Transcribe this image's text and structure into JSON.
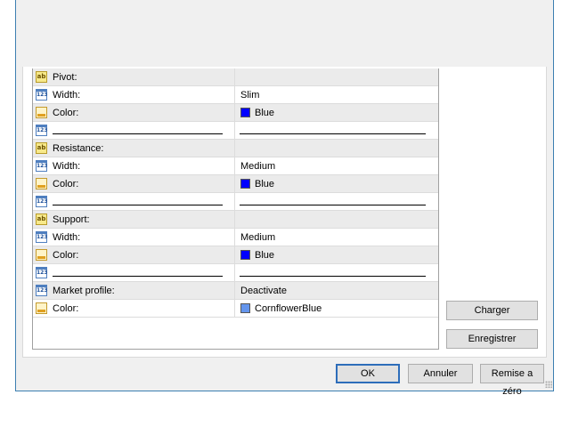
{
  "properties": [
    {
      "icon": "ab-icon",
      "label": "Pivot:",
      "value": "",
      "shaded": true
    },
    {
      "icon": "number-icon",
      "label": "Width:",
      "value": "Slim",
      "shaded": false
    },
    {
      "icon": "color-icon",
      "label": "Color:",
      "value": "Blue",
      "swatch": "#0000ff",
      "shaded": true
    },
    {
      "icon": "number-icon",
      "label": "",
      "value": "",
      "line": true,
      "shaded": false
    },
    {
      "icon": "ab-icon",
      "label": "Resistance:",
      "value": "",
      "shaded": true
    },
    {
      "icon": "number-icon",
      "label": "Width:",
      "value": "Medium",
      "shaded": false
    },
    {
      "icon": "color-icon",
      "label": "Color:",
      "value": "Blue",
      "swatch": "#0000ff",
      "shaded": true
    },
    {
      "icon": "number-icon",
      "label": "",
      "value": "",
      "line": true,
      "shaded": false
    },
    {
      "icon": "ab-icon",
      "label": "Support:",
      "value": "",
      "shaded": true
    },
    {
      "icon": "number-icon",
      "label": "Width:",
      "value": "Medium",
      "shaded": false
    },
    {
      "icon": "color-icon",
      "label": "Color:",
      "value": "Blue",
      "swatch": "#0000ff",
      "shaded": true
    },
    {
      "icon": "number-icon",
      "label": "",
      "value": "",
      "line": true,
      "shaded": false
    },
    {
      "icon": "number-icon",
      "label": "Market profile:",
      "value": "Deactivate",
      "shaded": true
    },
    {
      "icon": "color-icon",
      "label": "Color:",
      "value": "CornflowerBlue",
      "swatch": "#6495ed",
      "shaded": false
    }
  ],
  "side_buttons": {
    "load": "Charger",
    "save": "Enregistrer"
  },
  "footer_buttons": {
    "ok": "OK",
    "cancel": "Annuler",
    "reset": "Remise a zéro"
  },
  "colors": {
    "accent": "#2d6dba",
    "window_border": "#3c7fb1"
  }
}
